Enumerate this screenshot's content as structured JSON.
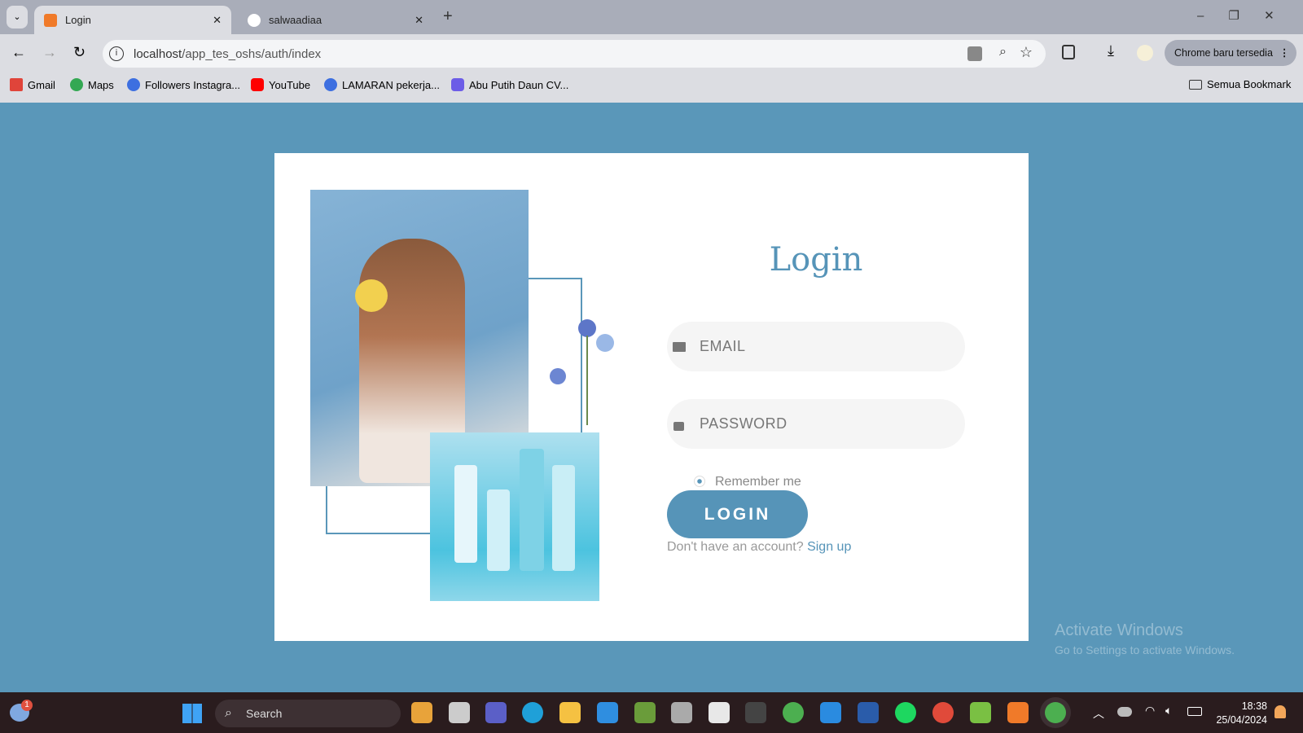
{
  "browser": {
    "tabs": [
      {
        "label": "Login",
        "active": true
      },
      {
        "label": "salwaadiaa",
        "active": false
      }
    ],
    "url_host": "localhost",
    "url_path": "/app_tes_oshs/auth/index",
    "update_label": "Chrome baru tersedia",
    "bookmarks": [
      "Gmail",
      "Maps",
      "Followers Instagra...",
      "YouTube",
      "LAMARAN pekerja...",
      "Abu Putih Daun CV..."
    ],
    "all_bookmarks": "Semua Bookmark"
  },
  "login": {
    "title": "Login",
    "email_placeholder": "EMAIL",
    "password_placeholder": "PASSWORD",
    "remember": "Remember me",
    "button": "LOGIN",
    "no_account": "Don't have an account?",
    "signup": "Sign up"
  },
  "watermark": {
    "title": "Activate Windows",
    "subtitle": "Go to Settings to activate Windows."
  },
  "taskbar": {
    "search": "Search",
    "time": "18:38",
    "date": "25/04/2024",
    "notif_count": "1"
  },
  "colors": {
    "accent": "#5694b8",
    "background": "#5a97b9"
  }
}
